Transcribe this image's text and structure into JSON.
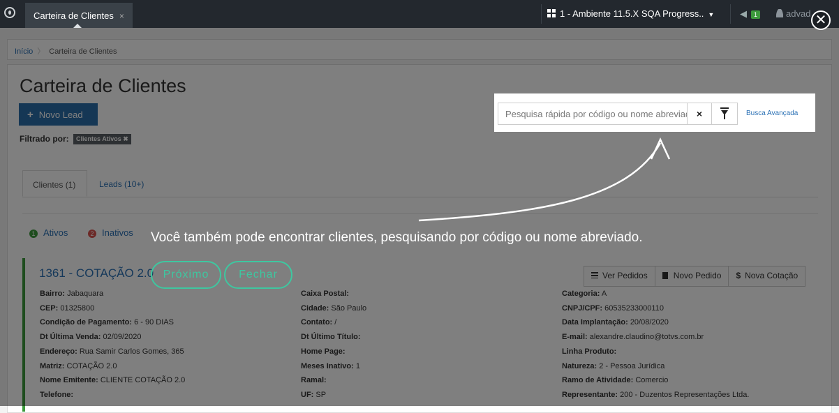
{
  "topbar": {
    "tab_label": "Carteira de Clientes",
    "tab_close": "×",
    "environment": "1 - Ambiente 11.5.X SQA Progress..",
    "notifications_count": "1",
    "user": "advad"
  },
  "breadcrumb": {
    "home": "Início",
    "current": "Carteira de Clientes"
  },
  "page": {
    "title": "Carteira de Clientes",
    "new_lead_label": "Novo Lead",
    "filter_label": "Filtrado por:",
    "filter_tag": "Clientes Ativos"
  },
  "tabs": [
    {
      "label": "Clientes (1)"
    },
    {
      "label": "Leads (10+)"
    }
  ],
  "legend": [
    {
      "num": "1",
      "label": "Ativos",
      "color": "#3c9a3c"
    },
    {
      "num": "2",
      "label": "Inativos",
      "color": "#d9534f"
    }
  ],
  "search": {
    "placeholder": "Pesquisa rápida por código ou nome abreviado",
    "clear_icon": "×",
    "advanced_label": "Busca Avançada"
  },
  "record": {
    "title": "1361 - COTAÇÃO 2.0",
    "actions": [
      "Ver Pedidos",
      "Novo Pedido",
      "Nova Cotação"
    ],
    "col1": [
      {
        "label": "Bairro:",
        "value": "Jabaquara"
      },
      {
        "label": "CEP:",
        "value": "01325800"
      },
      {
        "label": "Condição de Pagamento:",
        "value": "6 - 90 DIAS"
      },
      {
        "label": "Dt Última Venda:",
        "value": "02/09/2020"
      },
      {
        "label": "Endereço:",
        "value": "Rua Samir Carlos Gomes, 365"
      },
      {
        "label": "Matriz:",
        "value": "COTAÇÃO 2.0"
      },
      {
        "label": "Nome Emitente:",
        "value": "CLIENTE COTAÇÃO 2.0"
      },
      {
        "label": "Telefone:",
        "value": ""
      }
    ],
    "col2": [
      {
        "label": "Caixa Postal:",
        "value": ""
      },
      {
        "label": "Cidade:",
        "value": "São Paulo"
      },
      {
        "label": "Contato:",
        "value": "/"
      },
      {
        "label": "Dt Último Título:",
        "value": ""
      },
      {
        "label": "Home Page:",
        "value": ""
      },
      {
        "label": "Meses Inativo:",
        "value": "1"
      },
      {
        "label": "Ramal:",
        "value": ""
      },
      {
        "label": "UF:",
        "value": "SP"
      }
    ],
    "col3": [
      {
        "label": "Categoria:",
        "value": "A"
      },
      {
        "label": "CNPJ/CPF:",
        "value": "60535233000110"
      },
      {
        "label": "Data Implantação:",
        "value": "20/08/2020"
      },
      {
        "label": "E-mail:",
        "value": "alexandre.claudino@totvs.com.br"
      },
      {
        "label": "Linha Produto:",
        "value": ""
      },
      {
        "label": "Natureza:",
        "value": "2 - Pessoa Jurídica"
      },
      {
        "label": "Ramo de Atividade:",
        "value": "Comercio"
      },
      {
        "label": "Representante:",
        "value": "200 - Duzentos Representações Ltda."
      }
    ]
  },
  "tour": {
    "message": "Você também pode encontrar clientes, pesquisando por código ou nome abreviado.",
    "next_label": "Próximo",
    "close_label": "Fechar",
    "close_icon": "✕"
  }
}
